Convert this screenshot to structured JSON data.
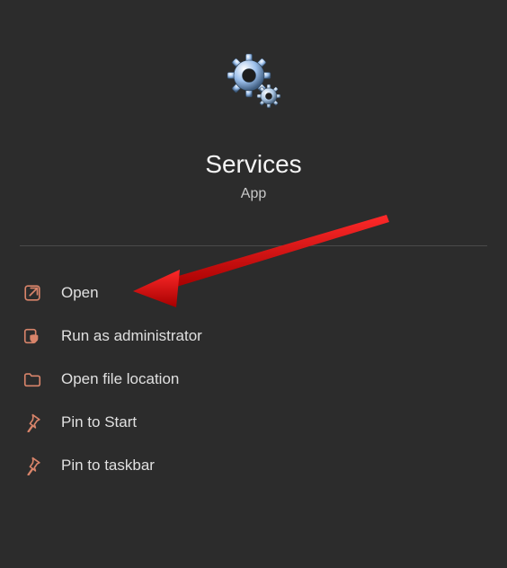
{
  "app": {
    "title": "Services",
    "subtitle": "App"
  },
  "menu": {
    "items": [
      {
        "label": "Open"
      },
      {
        "label": "Run as administrator"
      },
      {
        "label": "Open file location"
      },
      {
        "label": "Pin to Start"
      },
      {
        "label": "Pin to taskbar"
      }
    ]
  },
  "annotation": {
    "type": "arrow",
    "points_to": "menu-item-open",
    "color": "#d31111"
  }
}
